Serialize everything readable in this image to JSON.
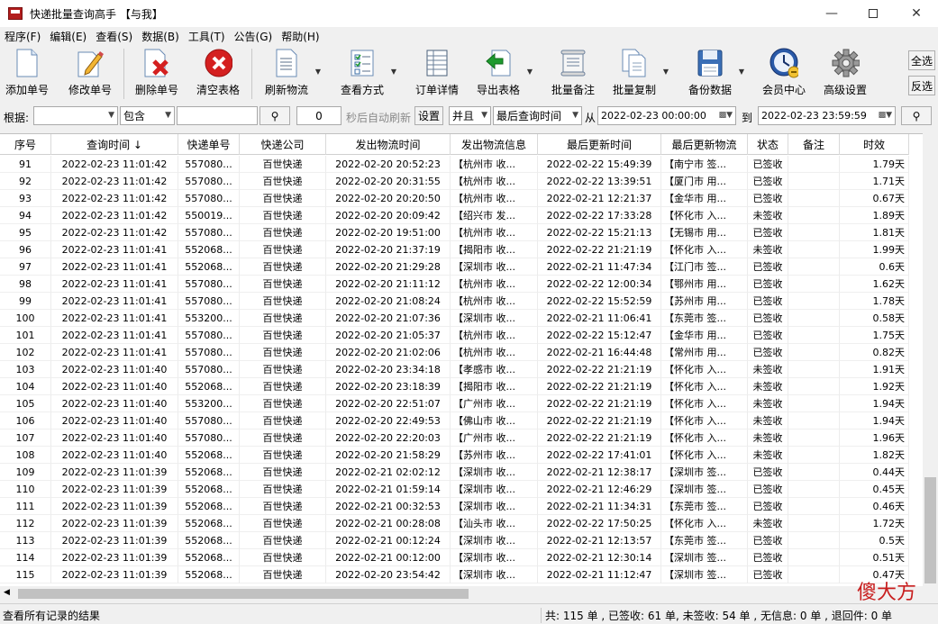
{
  "window": {
    "title": "快递批量查询高手 【与我】"
  },
  "menu": [
    "程序(F)",
    "编辑(E)",
    "查看(S)",
    "数据(B)",
    "工具(T)",
    "公告(G)",
    "帮助(H)"
  ],
  "toolbar": [
    {
      "name": "add-number",
      "label": "添加单号",
      "icon": "page-icon"
    },
    {
      "name": "edit-number",
      "label": "修改单号",
      "icon": "pencil-page-icon"
    },
    {
      "name": "delete-number",
      "label": "删除单号",
      "icon": "page-red-x-icon"
    },
    {
      "name": "clear-table",
      "label": "清空表格",
      "icon": "red-x-circle-icon"
    },
    {
      "name": "refresh-logistics",
      "label": "刷新物流",
      "icon": "doc-lines-icon"
    },
    {
      "name": "view-mode",
      "label": "查看方式",
      "icon": "checklist-icon"
    },
    {
      "name": "order-details",
      "label": "订单详情",
      "icon": "table-icon"
    },
    {
      "name": "export-table",
      "label": "导出表格",
      "icon": "export-arrow-icon"
    },
    {
      "name": "batch-note",
      "label": "批量备注",
      "icon": "scroll-icon"
    },
    {
      "name": "batch-copy",
      "label": "批量复制",
      "icon": "copy-icon"
    },
    {
      "name": "backup-data",
      "label": "备份数据",
      "icon": "floppy-icon"
    },
    {
      "name": "member-center",
      "label": "会员中心",
      "icon": "clock-globe-icon"
    },
    {
      "name": "advanced-settings",
      "label": "高级设置",
      "icon": "gear-icon"
    }
  ],
  "side_buttons": {
    "select_all": "全选",
    "invert": "反选"
  },
  "filter": {
    "basis_label": "根据:",
    "basis_value": "",
    "match_value": "包含",
    "keyword": "",
    "refresh_seconds": "0",
    "refresh_hint": "秒后自动刷新",
    "set_label": "设置",
    "logic_value": "并且",
    "field_value": "最后查询时间",
    "from_label": "从",
    "from_value": "2022-02-23 00:00:00",
    "to_label": "到",
    "to_value": "2022-02-23 23:59:59"
  },
  "columns": [
    "序号",
    "查询时间 ↓",
    "快递单号",
    "快递公司",
    "发出物流时间",
    "发出物流信息",
    "最后更新时间",
    "最后更新物流",
    "状态",
    "备注",
    "时效"
  ],
  "rows": [
    [
      "91",
      "2022-02-23 11:01:42",
      "557080...",
      "百世快递",
      "2022-02-20 20:52:23",
      "【杭州市 收...",
      "2022-02-22 15:49:39",
      "【南宁市 签...",
      "已签收",
      "",
      "1.79天"
    ],
    [
      "92",
      "2022-02-23 11:01:42",
      "557080...",
      "百世快递",
      "2022-02-20 20:31:55",
      "【杭州市 收...",
      "2022-02-22 13:39:51",
      "【厦门市 用...",
      "已签收",
      "",
      "1.71天"
    ],
    [
      "93",
      "2022-02-23 11:01:42",
      "557080...",
      "百世快递",
      "2022-02-20 20:20:50",
      "【杭州市 收...",
      "2022-02-21 12:21:37",
      "【金华市 用...",
      "已签收",
      "",
      "0.67天"
    ],
    [
      "94",
      "2022-02-23 11:01:42",
      "550019...",
      "百世快递",
      "2022-02-20 20:09:42",
      "【绍兴市 发...",
      "2022-02-22 17:33:28",
      "【怀化市 入...",
      "未签收",
      "",
      "1.89天"
    ],
    [
      "95",
      "2022-02-23 11:01:42",
      "557080...",
      "百世快递",
      "2022-02-20 19:51:00",
      "【杭州市 收...",
      "2022-02-22 15:21:13",
      "【无锡市 用...",
      "已签收",
      "",
      "1.81天"
    ],
    [
      "96",
      "2022-02-23 11:01:41",
      "552068...",
      "百世快递",
      "2022-02-20 21:37:19",
      "【揭阳市 收...",
      "2022-02-22 21:21:19",
      "【怀化市 入...",
      "未签收",
      "",
      "1.99天"
    ],
    [
      "97",
      "2022-02-23 11:01:41",
      "552068...",
      "百世快递",
      "2022-02-20 21:29:28",
      "【深圳市 收...",
      "2022-02-21 11:47:34",
      "【江门市 签...",
      "已签收",
      "",
      "0.6天"
    ],
    [
      "98",
      "2022-02-23 11:01:41",
      "557080...",
      "百世快递",
      "2022-02-20 21:11:12",
      "【杭州市 收...",
      "2022-02-22 12:00:34",
      "【鄂州市 用...",
      "已签收",
      "",
      "1.62天"
    ],
    [
      "99",
      "2022-02-23 11:01:41",
      "557080...",
      "百世快递",
      "2022-02-20 21:08:24",
      "【杭州市 收...",
      "2022-02-22 15:52:59",
      "【苏州市 用...",
      "已签收",
      "",
      "1.78天"
    ],
    [
      "100",
      "2022-02-23 11:01:41",
      "553200...",
      "百世快递",
      "2022-02-20 21:07:36",
      "【深圳市 收...",
      "2022-02-21 11:06:41",
      "【东莞市 签...",
      "已签收",
      "",
      "0.58天"
    ],
    [
      "101",
      "2022-02-23 11:01:41",
      "557080...",
      "百世快递",
      "2022-02-20 21:05:37",
      "【杭州市 收...",
      "2022-02-22 15:12:47",
      "【金华市 用...",
      "已签收",
      "",
      "1.75天"
    ],
    [
      "102",
      "2022-02-23 11:01:41",
      "557080...",
      "百世快递",
      "2022-02-20 21:02:06",
      "【杭州市 收...",
      "2022-02-21 16:44:48",
      "【常州市 用...",
      "已签收",
      "",
      "0.82天"
    ],
    [
      "103",
      "2022-02-23 11:01:40",
      "557080...",
      "百世快递",
      "2022-02-20 23:34:18",
      "【孝感市 收...",
      "2022-02-22 21:21:19",
      "【怀化市 入...",
      "未签收",
      "",
      "1.91天"
    ],
    [
      "104",
      "2022-02-23 11:01:40",
      "552068...",
      "百世快递",
      "2022-02-20 23:18:39",
      "【揭阳市 收...",
      "2022-02-22 21:21:19",
      "【怀化市 入...",
      "未签收",
      "",
      "1.92天"
    ],
    [
      "105",
      "2022-02-23 11:01:40",
      "553200...",
      "百世快递",
      "2022-02-20 22:51:07",
      "【广州市 收...",
      "2022-02-22 21:21:19",
      "【怀化市 入...",
      "未签收",
      "",
      "1.94天"
    ],
    [
      "106",
      "2022-02-23 11:01:40",
      "557080...",
      "百世快递",
      "2022-02-20 22:49:53",
      "【佛山市 收...",
      "2022-02-22 21:21:19",
      "【怀化市 入...",
      "未签收",
      "",
      "1.94天"
    ],
    [
      "107",
      "2022-02-23 11:01:40",
      "557080...",
      "百世快递",
      "2022-02-20 22:20:03",
      "【广州市 收...",
      "2022-02-22 21:21:19",
      "【怀化市 入...",
      "未签收",
      "",
      "1.96天"
    ],
    [
      "108",
      "2022-02-23 11:01:40",
      "552068...",
      "百世快递",
      "2022-02-20 21:58:29",
      "【苏州市 收...",
      "2022-02-22 17:41:01",
      "【怀化市 入...",
      "未签收",
      "",
      "1.82天"
    ],
    [
      "109",
      "2022-02-23 11:01:39",
      "552068...",
      "百世快递",
      "2022-02-21 02:02:12",
      "【深圳市 收...",
      "2022-02-21 12:38:17",
      "【深圳市 签...",
      "已签收",
      "",
      "0.44天"
    ],
    [
      "110",
      "2022-02-23 11:01:39",
      "552068...",
      "百世快递",
      "2022-02-21 01:59:14",
      "【深圳市 收...",
      "2022-02-21 12:46:29",
      "【深圳市 签...",
      "已签收",
      "",
      "0.45天"
    ],
    [
      "111",
      "2022-02-23 11:01:39",
      "552068...",
      "百世快递",
      "2022-02-21 00:32:53",
      "【深圳市 收...",
      "2022-02-21 11:34:31",
      "【东莞市 签...",
      "已签收",
      "",
      "0.46天"
    ],
    [
      "112",
      "2022-02-23 11:01:39",
      "552068...",
      "百世快递",
      "2022-02-21 00:28:08",
      "【汕头市 收...",
      "2022-02-22 17:50:25",
      "【怀化市 入...",
      "未签收",
      "",
      "1.72天"
    ],
    [
      "113",
      "2022-02-23 11:01:39",
      "552068...",
      "百世快递",
      "2022-02-21 00:12:24",
      "【深圳市 收...",
      "2022-02-21 12:13:57",
      "【东莞市 签...",
      "已签收",
      "",
      "0.5天"
    ],
    [
      "114",
      "2022-02-23 11:01:39",
      "552068...",
      "百世快递",
      "2022-02-21 00:12:00",
      "【深圳市 收...",
      "2022-02-21 12:30:14",
      "【深圳市 签...",
      "已签收",
      "",
      "0.51天"
    ],
    [
      "115",
      "2022-02-23 11:01:39",
      "552068...",
      "百世快递",
      "2022-02-20 23:54:42",
      "【深圳市 收...",
      "2022-02-21 11:12:47",
      "【深圳市 签...",
      "已签收",
      "",
      "0.47天"
    ]
  ],
  "status": {
    "left": "查看所有记录的结果",
    "right": "共: 115 单 , 已签收: 61 单, 未签收: 54 单 , 无信息: 0 单 , 退回件: 0 单"
  },
  "watermark": "傻大方",
  "colors": {
    "watermark_red": "#c81e1e",
    "clear_red": "#d42020",
    "export_green": "#1e9a2e"
  }
}
